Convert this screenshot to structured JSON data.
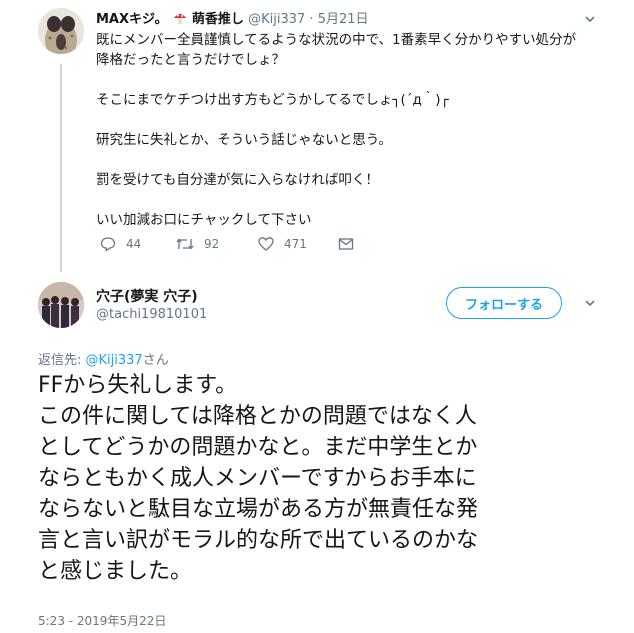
{
  "tweet1": {
    "display_name": "MAXキジ。",
    "display_name_suffix": "萌香推し",
    "handle": "@Kiji337",
    "separator": "·",
    "date": "5月21日",
    "lines": [
      "既にメンバー全員謹慎してるような状況の中で、1番素早く分かりやすい処分が",
      "降格だったと言うだけでしょ？",
      "",
      "そこにまでケチつけ出す方もどうかしてるでしょ┐(´д｀)┌",
      "",
      "研究生に失礼とか、そういう話じゃないと思う。",
      "",
      "罰を受けても自分達が気に入らなければ叩く！",
      "",
      "いい加減お口にチャックして下さい"
    ],
    "replies": "44",
    "retweets": "92",
    "likes": "471"
  },
  "tweet2": {
    "display_name": "穴子(夢実 穴子)",
    "handle": "@tachi19810101",
    "follow_label": "フォローする",
    "reply_prefix": "返信先: ",
    "reply_handle": "@Kiji337",
    "reply_suffix": "さん",
    "lines": [
      "FFから失礼します。",
      "この件に関しては降格とかの問題ではなく人",
      "としてどうかの問題かなと。まだ中学生とか",
      "ならともかく成人メンバーですからお手本に",
      "ならないと駄目な立場がある方が無責任な発",
      "言と言い訳がモラル的な所で出ているのかな",
      "と感じました。"
    ],
    "timestamp": "5:23 - 2019年5月22日"
  },
  "colors": {
    "accent": "#1da1f2",
    "secondary_text": "#657786",
    "thread_line": "#ccd6dd"
  }
}
